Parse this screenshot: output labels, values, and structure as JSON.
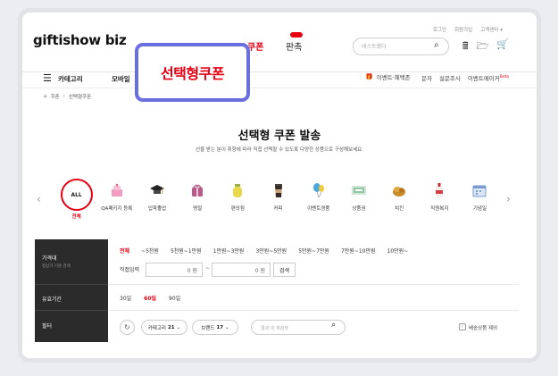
{
  "header": {
    "logo": "giftishow biz",
    "utils": [
      "로그인",
      "회원가입",
      "고객센터 ▾"
    ],
    "coupon_tab": "쿠폰",
    "sale_tab": "판촉",
    "search_placeholder": "테스트했다"
  },
  "nav": {
    "category": "카테고리",
    "mobile": "모바일",
    "event_benefit": "이벤트·혜택존",
    "links": [
      "문자",
      "설문조사"
    ],
    "event_maker": "이벤트메이커",
    "beta": "Beta"
  },
  "breadcrumb": [
    "쿠폰",
    "선택형쿠폰"
  ],
  "callout": "선택형쿠폰",
  "page": {
    "title": "선택형 쿠폰 발송",
    "subtitle": "선물 받는 분이 취향에 따라 직접 선택할 수 있도록 다양한 상품으로 구성해보세요."
  },
  "categories": [
    {
      "label": "전체",
      "icon": "all-icon",
      "badge": "ALL"
    },
    {
      "label": "QA패키지 등록",
      "icon": "cake-icon"
    },
    {
      "label": "입학졸업",
      "icon": "graduation-cap-icon"
    },
    {
      "label": "명절",
      "icon": "holiday-gift-icon"
    },
    {
      "label": "편의점",
      "icon": "milk-bottle-icon"
    },
    {
      "label": "커피",
      "icon": "coffee-cup-icon"
    },
    {
      "label": "이벤트경품",
      "icon": "balloon-icon"
    },
    {
      "label": "상품권",
      "icon": "gift-card-icon"
    },
    {
      "label": "치킨",
      "icon": "chicken-icon"
    },
    {
      "label": "직원복지",
      "icon": "bottle-icon"
    },
    {
      "label": "기념일",
      "icon": "calendar-icon"
    }
  ],
  "filters": {
    "price_label": "가격대",
    "price_sub": "정상가 기준 검색",
    "prices": [
      "전체",
      "~5천원",
      "5천원~1만원",
      "1만원~3만원",
      "3만원~5만원",
      "5만원~7만원",
      "7만원~10만원",
      "10만원~"
    ],
    "direct_label": "직접입력",
    "min_unit": "0  원",
    "max_unit": "0  원",
    "tilde": "~",
    "search_btn": "검색",
    "validity_label": "유효기간",
    "validity": [
      "30일",
      "60일",
      "90일"
    ],
    "filter_label": "필터",
    "category_pill": "카테고리",
    "category_count": "21",
    "brand_pill": "브랜드",
    "brand_count": "17",
    "result_search_placeholder": "결과 내 재검색",
    "exclude_shipping": "배송상품 제외"
  },
  "colors": {
    "accent": "#e60012",
    "callout_border": "#6a6fe0",
    "dark_panel": "#2b2b2b"
  }
}
